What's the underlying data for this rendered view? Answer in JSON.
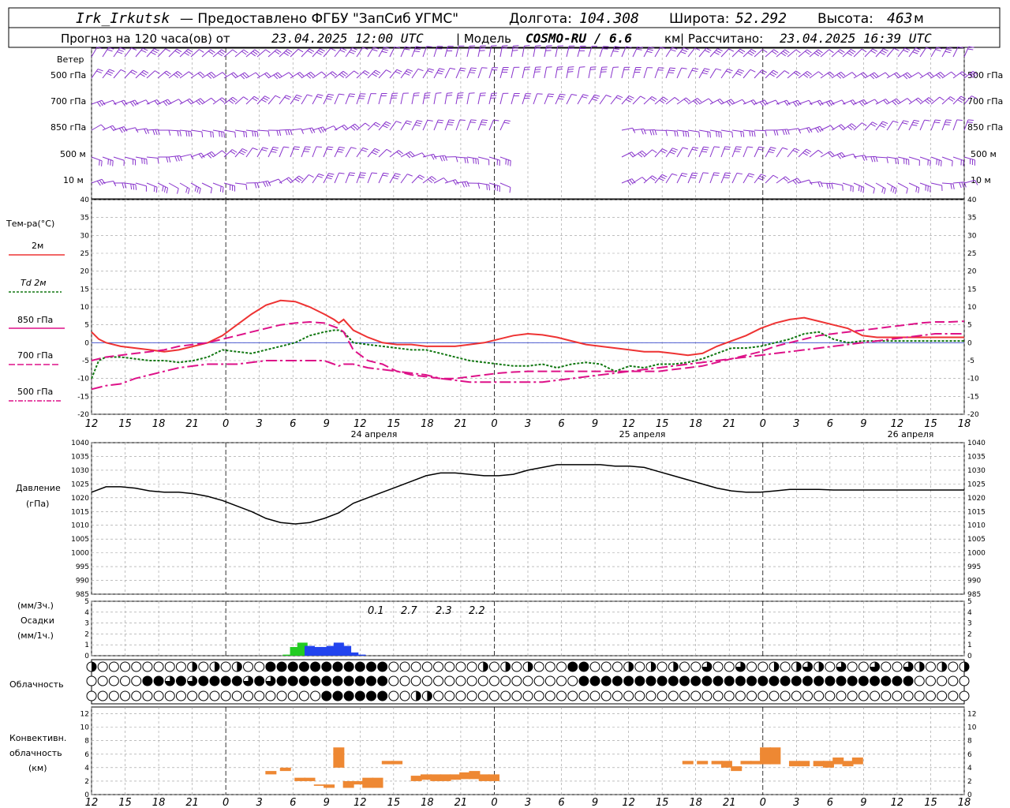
{
  "header": {
    "station": "Irk_Irkutsk",
    "provider": "— Предоставлено ФГБУ \"ЗапСиб УГМС\"",
    "lon_label": "Долгота:",
    "lon": "104.308",
    "lat_label": "Широта:",
    "lat": "52.292",
    "alt_label": "Высота:",
    "alt": "463",
    "alt_unit": "м",
    "forecast_prefix": "Прогноз на 120 часа(ов) от",
    "forecast_time": "23.04.2025 12:00 UTC",
    "model_prefix": "| Модель",
    "model": "COSMO-RU / 6.6",
    "model_unit": "км",
    "computed_prefix": "| Рассчитано:",
    "computed_time": "23.04.2025 16:39 UTC"
  },
  "colors": {
    "t2m": "#ee3333",
    "td2m": "#117711",
    "t850": "#dd1188",
    "wind": "#8833cc",
    "precip_3h": "#2244ee",
    "precip_1h": "#22cc22",
    "convective": "#ee8833"
  },
  "wind_panel": {
    "title": "Ветер",
    "levels": [
      "500 гПа",
      "700 гПа",
      "850 гПа",
      "500 м",
      "10 м"
    ]
  },
  "temp_panel": {
    "title": "Тем-ра(°C)",
    "legend": [
      "2м",
      "Td 2м",
      "850 гПа",
      "700 гПа",
      "500 гПа"
    ]
  },
  "pressure_panel": {
    "title": "Давление",
    "unit": "(гПа)"
  },
  "precip_panel": {
    "unit_3h": "(мм/3ч.)",
    "title": "Осадки",
    "unit_1h": "(мм/1ч.)",
    "totals": [
      "0.1",
      "2.7",
      "2.3",
      "2.2"
    ]
  },
  "cloud_panel": {
    "title": "Облачность"
  },
  "conv_panel": {
    "title_1": "Конвективн.",
    "title_2": "облачность",
    "unit": "(км)"
  },
  "x_axis": {
    "hour_labels": [
      "12",
      "15",
      "18",
      "21",
      "0",
      "3",
      "6",
      "9",
      "12",
      "15",
      "18",
      "21",
      "0",
      "3",
      "6",
      "9",
      "12",
      "15",
      "18",
      "21",
      "0",
      "3",
      "6",
      "9",
      "12",
      "15",
      "18"
    ],
    "dates": [
      "24 апреля",
      "25 апреля",
      "26 апреля"
    ]
  },
  "chart_data": [
    {
      "type": "line",
      "title": "Тем-ра(°C)",
      "x_hours": [
        0,
        1.5,
        3,
        6,
        9,
        12,
        15,
        18,
        21,
        24,
        27,
        30,
        33,
        36,
        39,
        42,
        45,
        48,
        50,
        51,
        52,
        54,
        57,
        60,
        63,
        66,
        69,
        72,
        75,
        78,
        81,
        84,
        87,
        90,
        93,
        96,
        99,
        102,
        105,
        108,
        111,
        114,
        117,
        120,
        123,
        126,
        129,
        132,
        135,
        138,
        141,
        144,
        147,
        150,
        153,
        156,
        159,
        162,
        165,
        168,
        171,
        174,
        177,
        180
      ],
      "ylim": [
        -20,
        40
      ],
      "series": [
        {
          "name": "2м",
          "values": [
            3,
            1,
            0,
            -1,
            -1.5,
            -2,
            -2.5,
            -2,
            -1,
            0,
            2,
            5,
            8,
            10.5,
            11.8,
            11.5,
            10,
            8,
            6.5,
            5.5,
            6.5,
            3.5,
            1.5,
            0,
            -0.5,
            -0.5,
            -1,
            -1,
            -1,
            -0.5,
            0,
            1,
            2,
            2.5,
            2.2,
            1.5,
            0.5,
            -0.5,
            -1,
            -1.5,
            -2,
            -2.5,
            -2.5,
            -3,
            -3.5,
            -3,
            -1,
            0.5,
            2,
            4,
            5.5,
            6.5,
            7,
            6,
            5,
            4,
            2,
            1.5,
            1.5,
            1.5,
            1.5,
            1.5,
            1.5,
            1.5
          ]
        },
        {
          "name": "Td 2м",
          "values": [
            -10,
            -5,
            -4,
            -4,
            -4.5,
            -5,
            -5,
            -5.5,
            -5,
            -4,
            -2,
            -2.5,
            -3,
            -2,
            -1,
            0,
            2,
            3,
            3.5,
            3.5,
            3,
            0,
            -0.5,
            -1,
            -1.5,
            -2,
            -2,
            -3,
            -4,
            -5,
            -5.5,
            -6,
            -6.5,
            -6.5,
            -6,
            -7,
            -6,
            -5.5,
            -6,
            -8,
            -6.5,
            -7,
            -6,
            -6,
            -5.5,
            -4.5,
            -3,
            -1.5,
            -1.5,
            -1,
            0,
            1,
            2.5,
            3,
            1,
            0,
            0.5,
            0.5,
            0.5,
            0.5,
            0.5,
            0.5,
            0.5,
            0.5
          ]
        },
        {
          "name": "850 гПа",
          "values": [
            -5,
            -4.5,
            -4,
            -3.5,
            -3,
            -2.5,
            -2,
            -1,
            -0.5,
            0,
            1,
            2,
            3,
            4,
            5,
            5.5,
            5.8,
            5.5,
            4.5,
            4,
            3,
            -2,
            -5,
            -6,
            -8,
            -9,
            -9.5,
            -10,
            -10,
            -9.5,
            -9,
            -8.5,
            -8.2,
            -8,
            -8,
            -8,
            -8,
            -8,
            -8,
            -8,
            -8,
            -8,
            -8,
            -7.5,
            -7,
            -6.5,
            -5.5,
            -4.5,
            -3.5,
            -2.5,
            -1,
            0,
            1,
            2,
            2.5,
            3,
            3.5,
            4,
            4.5,
            5,
            5.5,
            5.8,
            5.8,
            6
          ]
        },
        {
          "name": "700 гПа",
          "values": [
            -5,
            -4.5,
            -4,
            -3.8,
            -3.5,
            -3.2,
            -3,
            -2.8,
            -2.5,
            -2.3,
            -2.2,
            -2,
            -1.8,
            -1.7,
            -1.6,
            -1.5,
            -1.5,
            -1.5,
            -1.5,
            -1.5,
            -1.5,
            -1.5,
            -1.4,
            -1.3,
            -1.2,
            -1.1,
            -1.0,
            -0.9,
            -0.8,
            -0.7,
            -0.6,
            -0.5,
            -0.5,
            -0.5,
            -0.5,
            -0.5,
            -0.5,
            -0.5,
            -0.5,
            -0.5,
            -0.5,
            -0.5,
            -0.5,
            -0.5,
            -0.5,
            -0.5,
            -0.5,
            -0.5,
            -0.5,
            -0.5,
            -0.5,
            -0.5,
            -0.5,
            -0.5,
            -0.5,
            -0.5,
            -0.5,
            -0.5,
            -0.5,
            -0.5,
            -0.5,
            -0.5,
            -0.5,
            -0.5
          ]
        },
        {
          "name": "500 гПа",
          "values": [
            -13,
            -12.5,
            -12,
            -11.5,
            -10,
            -9,
            -8,
            -7,
            -6.5,
            -6,
            -6,
            -6,
            -5.5,
            -5,
            -5,
            -5,
            -5,
            -5,
            -6,
            -6.5,
            -6,
            -6,
            -7,
            -7.5,
            -8,
            -8.5,
            -9,
            -10,
            -10.5,
            -11,
            -11,
            -11,
            -11,
            -11,
            -11,
            -10.5,
            -10,
            -9.5,
            -9,
            -8.5,
            -8,
            -7.5,
            -7,
            -6.5,
            -6,
            -5.5,
            -5,
            -4.5,
            -4,
            -3.5,
            -3,
            -2.5,
            -2,
            -1.5,
            -1,
            -0.5,
            0,
            0.5,
            1,
            1.5,
            2,
            2.5,
            2.5,
            2.5
          ]
        }
      ]
    },
    {
      "type": "line",
      "title": "Давление",
      "ylabel": "(гПа)",
      "ylim": [
        985,
        1040
      ],
      "x_hours": [
        0,
        3,
        6,
        9,
        12,
        15,
        18,
        21,
        24,
        27,
        30,
        33,
        36,
        39,
        42,
        45,
        48,
        51,
        54,
        57,
        60,
        63,
        66,
        69,
        72,
        75,
        78,
        81,
        84,
        87,
        90,
        93,
        96,
        99,
        102,
        105,
        108,
        111,
        114,
        117,
        120,
        123,
        126,
        129,
        132,
        135,
        138,
        141,
        144,
        147,
        150,
        153,
        156,
        159,
        162,
        165,
        168,
        171,
        174,
        177,
        180
      ],
      "series": [
        {
          "name": "Давление",
          "values": [
            1022,
            1024,
            1024,
            1023.5,
            1022.5,
            1022,
            1022,
            1021.5,
            1020.5,
            1019,
            1017,
            1015,
            1012.5,
            1011,
            1010.5,
            1011,
            1012.5,
            1014.5,
            1018,
            1020,
            1022,
            1024,
            1026,
            1028,
            1029,
            1029,
            1028.5,
            1028,
            1028,
            1028.5,
            1030,
            1031,
            1032,
            1032,
            1032,
            1032,
            1031.5,
            1031.5,
            1031,
            1029.5,
            1028,
            1026.5,
            1025,
            1023.5,
            1022.5,
            1022,
            1022,
            1022.5,
            1023,
            1023,
            1023,
            1022.8,
            1022.8,
            1022.8,
            1022.8,
            1022.8,
            1022.8,
            1022.8,
            1022.8,
            1022.8,
            1022.8
          ]
        }
      ]
    },
    {
      "type": "bar",
      "title": "Осадки",
      "ylabel": "(мм/3ч.) (мм/1ч.)",
      "ylim": [
        0,
        5
      ],
      "series": [
        {
          "name": "(мм/1ч.)",
          "x_hours": [
            40.5,
            42,
            43.5
          ],
          "values": [
            0.1,
            0.8,
            1.2
          ]
        },
        {
          "name": "(мм/3ч.)",
          "x_hours": [
            45,
            46.5,
            48,
            49.5,
            51,
            52.5,
            54,
            55.5
          ],
          "values": [
            0.9,
            0.8,
            0.8,
            0.9,
            1.2,
            0.9,
            0.3,
            0.1
          ]
        }
      ]
    },
    {
      "type": "bar",
      "title": "Конвективн. облачность",
      "ylabel": "(км)",
      "ylim": [
        0,
        13
      ],
      "segments": [
        {
          "x": 37,
          "bottom": 3,
          "top": 3.5
        },
        {
          "x": 40,
          "bottom": 3.5,
          "top": 4
        },
        {
          "x": 43,
          "bottom": 2,
          "top": 2.5
        },
        {
          "x": 45,
          "bottom": 2,
          "top": 2.5
        },
        {
          "x": 47,
          "bottom": 1.3,
          "top": 1.5
        },
        {
          "x": 49,
          "bottom": 1,
          "top": 1.5
        },
        {
          "x": 51,
          "bottom": 4,
          "top": 7
        },
        {
          "x": 53,
          "bottom": 1,
          "top": 2
        },
        {
          "x": 55,
          "bottom": 1.5,
          "top": 2
        },
        {
          "x": 57,
          "bottom": 1,
          "top": 2.5
        },
        {
          "x": 59,
          "bottom": 1,
          "top": 2.5
        },
        {
          "x": 61,
          "bottom": 4.5,
          "top": 5
        },
        {
          "x": 63,
          "bottom": 4.5,
          "top": 5
        },
        {
          "x": 67,
          "bottom": 2,
          "top": 2.8
        },
        {
          "x": 69,
          "bottom": 2.2,
          "top": 3
        },
        {
          "x": 71,
          "bottom": 2,
          "top": 3
        },
        {
          "x": 73,
          "bottom": 2,
          "top": 3
        },
        {
          "x": 75,
          "bottom": 2.2,
          "top": 3
        },
        {
          "x": 77,
          "bottom": 2.3,
          "top": 3.3
        },
        {
          "x": 79,
          "bottom": 2.3,
          "top": 3.5
        },
        {
          "x": 81,
          "bottom": 2,
          "top": 3
        },
        {
          "x": 83,
          "bottom": 2,
          "top": 3
        },
        {
          "x": 123,
          "bottom": 4.5,
          "top": 5
        },
        {
          "x": 126,
          "bottom": 4.5,
          "top": 5
        },
        {
          "x": 129,
          "bottom": 4.5,
          "top": 5
        },
        {
          "x": 131,
          "bottom": 4,
          "top": 5
        },
        {
          "x": 133,
          "bottom": 3.5,
          "top": 4.2
        },
        {
          "x": 135,
          "bottom": 4.5,
          "top": 5
        },
        {
          "x": 137,
          "bottom": 4.5,
          "top": 5
        },
        {
          "x": 139,
          "bottom": 4.5,
          "top": 7
        },
        {
          "x": 141,
          "bottom": 4.5,
          "top": 7
        },
        {
          "x": 145,
          "bottom": 4.2,
          "top": 5
        },
        {
          "x": 147,
          "bottom": 4.2,
          "top": 5
        },
        {
          "x": 150,
          "bottom": 4.2,
          "top": 5
        },
        {
          "x": 152,
          "bottom": 4,
          "top": 5
        },
        {
          "x": 154,
          "bottom": 4.5,
          "top": 5.5
        },
        {
          "x": 156,
          "bottom": 4.2,
          "top": 5
        },
        {
          "x": 158,
          "bottom": 4.5,
          "top": 5.5
        }
      ]
    }
  ]
}
